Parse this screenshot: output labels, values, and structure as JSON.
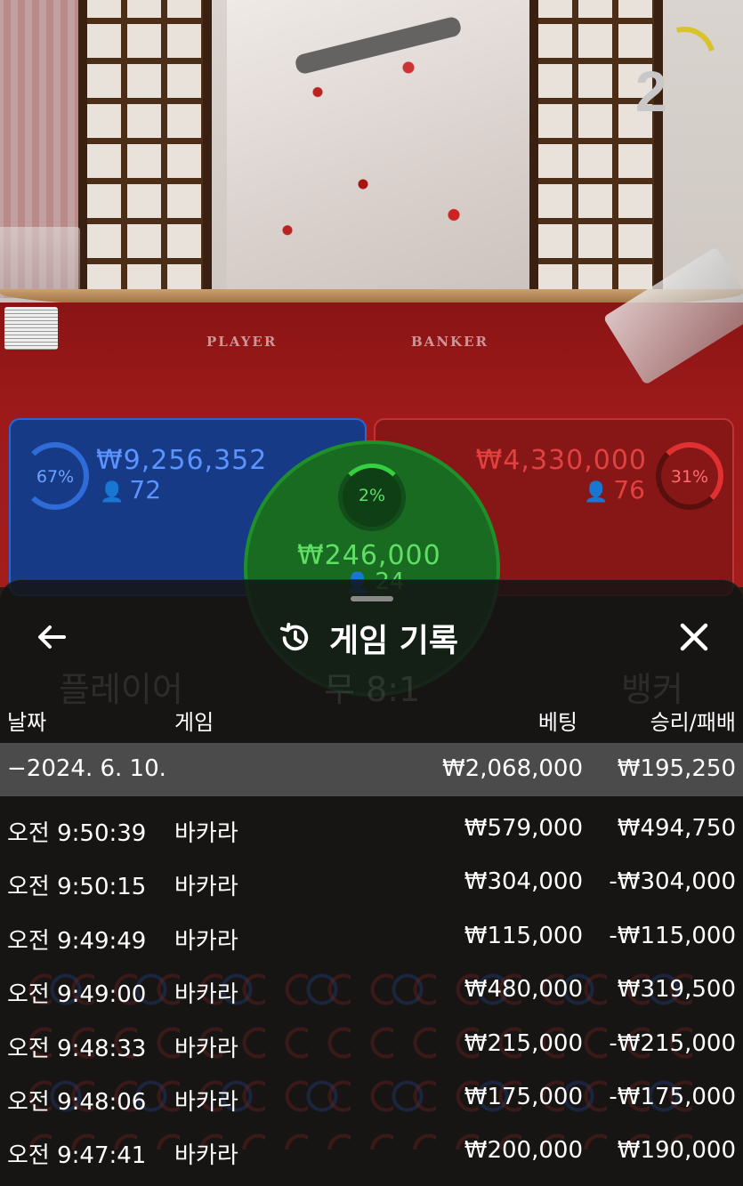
{
  "stream": {
    "round_number": "2",
    "table_labels": {
      "player": "PLAYER",
      "banker": "BANKER"
    },
    "bets": {
      "player": {
        "percent": "67%",
        "amount": "₩9,256,352",
        "players": "72",
        "color": "#2a66d6"
      },
      "banker": {
        "percent": "31%",
        "amount": "₩4,330,000",
        "players": "76",
        "color": "#c23232"
      },
      "tie": {
        "percent": "2%",
        "amount": "₩246,000",
        "players": "24",
        "color": "#1f8f2a"
      }
    }
  },
  "sheet": {
    "title": "게임 기록",
    "back_icon": "arrow-left-icon",
    "history_icon": "history-icon",
    "close_icon": "close-icon",
    "ghost_labels": [
      "플레이어",
      "무 8:1",
      "뱅커"
    ],
    "columns": {
      "date": "날짜",
      "game": "게임",
      "bet": "베팅",
      "win_loss": "승리/패배"
    },
    "date_group": {
      "date": "−2024. 6. 10.",
      "bet": "₩2,068,000",
      "win_loss": "₩195,250"
    },
    "records": [
      {
        "time": "오전 9:50:39",
        "game": "바카라",
        "bet": "₩579,000",
        "win_loss": "₩494,750"
      },
      {
        "time": "오전 9:50:15",
        "game": "바카라",
        "bet": "₩304,000",
        "win_loss": "-₩304,000"
      },
      {
        "time": "오전 9:49:49",
        "game": "바카라",
        "bet": "₩115,000",
        "win_loss": "-₩115,000"
      },
      {
        "time": "오전 9:49:00",
        "game": "바카라",
        "bet": "₩480,000",
        "win_loss": "₩319,500"
      },
      {
        "time": "오전 9:48:33",
        "game": "바카라",
        "bet": "₩215,000",
        "win_loss": "-₩215,000"
      },
      {
        "time": "오전 9:48:06",
        "game": "바카라",
        "bet": "₩175,000",
        "win_loss": "-₩175,000"
      },
      {
        "time": "오전 9:47:41",
        "game": "바카라",
        "bet": "₩200,000",
        "win_loss": "₩190,000"
      }
    ]
  }
}
